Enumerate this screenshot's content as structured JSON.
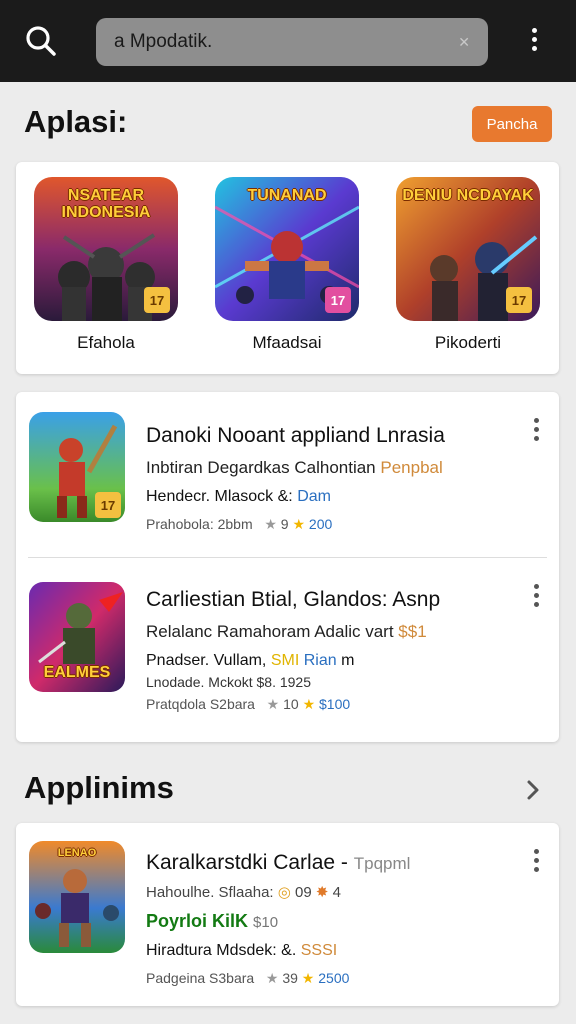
{
  "search": {
    "query": "a Mpodatik.",
    "clear_icon": "close-icon",
    "more_icon": "more-vertical-icon"
  },
  "section1": {
    "title": "Aplasi:",
    "action_label": "Pancha"
  },
  "featured": [
    {
      "art_title": "NSATEAR INDONESIA",
      "label": "Efahola",
      "tag": "17"
    },
    {
      "art_title": "TUNANAD",
      "label": "Mfaadsai",
      "tag": "17"
    },
    {
      "art_title": "DENIU NCDAYAK",
      "label": "Pikoderti",
      "tag": "17"
    }
  ],
  "list": [
    {
      "title": "Danoki Nooant appliand Lnrasia",
      "subtitle": "Inbtiran Degardkas Calhontian",
      "subtitle_accent": "Penpbal",
      "dev": "Hendecr. Mlasock &:",
      "dev_accent": "Dam",
      "meta": "Prahobola: 2bbm",
      "stat1": "9",
      "stat2": "200",
      "icon_tag": "17"
    },
    {
      "title": "Carliestian Btial, Glandos: Asnp",
      "subtitle": "Relalanc Ramahoram Adalic vart",
      "subtitle_accent": "$$1",
      "dev": "Pnadser. Vullam,",
      "dev_accent": "SMI",
      "dev_accent2": "Rian",
      "dev_suffix": "m",
      "extra": "Lnodade. Mckokt $8. 1925",
      "meta": "Pratqdola S2bara",
      "stat1": "10",
      "stat2": "$100",
      "icon_title": "EALMES"
    }
  ],
  "section2": {
    "title": "Applinims",
    "chevron": "chevron-right-icon"
  },
  "single": {
    "title": "Karalkarstdki Carlae -",
    "title_accent": "Tpqpml",
    "subtitle": "Hahoulhe. Sflaaha:",
    "subtitle_stat": "09",
    "subtitle_stat2": "4",
    "highlight": "Poyrloi KilK",
    "highlight_price": "$10",
    "dev": "Hiradtura Mdsdek: &.",
    "dev_accent": "SSSI",
    "meta": "Padgeina S3bara",
    "stat1": "39",
    "stat2": "2500",
    "icon_title": "LENAO"
  },
  "colors": {
    "topbar": "#1b1b1b",
    "accent_orange": "#e8792f",
    "star_gold": "#f2b600",
    "link_blue": "#2a6fc0"
  }
}
